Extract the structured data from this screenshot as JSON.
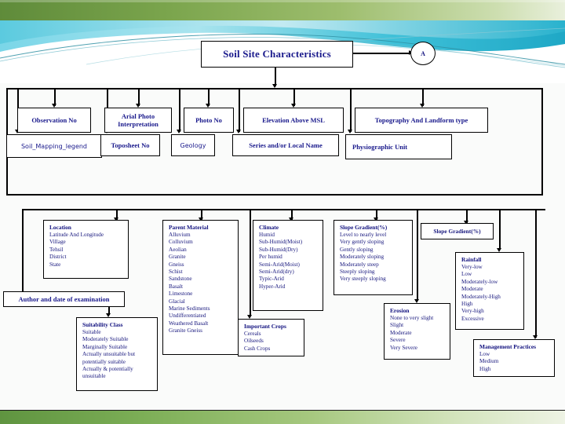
{
  "diagram": {
    "title": "Soil Site Characteristics",
    "connector_label": "A",
    "row1": [
      {
        "label": "Observation No"
      },
      {
        "label": "Arial Photo\nInterpretation"
      },
      {
        "label": "Photo  No"
      },
      {
        "label": "Elevation Above MSL"
      },
      {
        "label": "Topography And Landform type"
      }
    ],
    "row2": [
      {
        "label": "Soil_Mapping_legend"
      },
      {
        "label": "Toposheet No"
      },
      {
        "label": "Geology"
      },
      {
        "label": "Series and/or Local Name"
      },
      {
        "label": "Physiographic Unit"
      }
    ],
    "author_box": "Author and date of examination",
    "lists": [
      {
        "title": "Location",
        "items": [
          "Latitude  And Longitude",
          "Village",
          "Tehsil",
          "District",
          "State"
        ]
      },
      {
        "title": "Parent Material",
        "items": [
          "Alluvium",
          "Colluvium",
          "Aeolian",
          "Granite",
          "Gneiss",
          "Schist",
          "Sandstone",
          "Basalt",
          "Limestone",
          "Glacial",
          "Marine Sediments",
          "Undifferentiated",
          "Weathered Basalt",
          "Granite Gneiss"
        ]
      },
      {
        "title": "Climate",
        "items": [
          "Humid",
          "Sub-Humid(Moist)",
          "Sub-Humid(Dry)",
          "Per humid",
          "Semi-Arid(Moist)",
          "Semi-Arid(dry)",
          "Typic-Arid",
          "Hyper-Arid"
        ]
      },
      {
        "title": "Slope Gradient(%)",
        "items": [
          "Level to nearly level",
          "Very gently sloping",
          "Gently sloping",
          "Moderately sloping",
          "Moderately steep",
          "Steeply sloping",
          "Very steeply sloping"
        ]
      },
      {
        "title": "Slope Gradient(%)",
        "items": []
      },
      {
        "title": "Rainfall",
        "items": [
          "Very-low",
          "Low",
          "Moderately-low",
          "Moderate",
          "Moderately-High",
          "High",
          "Very-high",
          "Excessive"
        ]
      },
      {
        "title": "Erosion",
        "items": [
          "None to very slight",
          "Slight",
          "Moderate",
          "Severe",
          "Very Severe"
        ]
      },
      {
        "title": "Important Crops",
        "items": [
          "Cereals",
          "Oilseeds",
          "Cash Crops"
        ]
      },
      {
        "title": "Management Practices",
        "items": [
          "Low",
          "Medium",
          "High"
        ]
      },
      {
        "title": "Suitability Class",
        "items": [
          "Suitable",
          "Moderately Suitable",
          "Marginally Suitable",
          "Actually unsuitable but",
          "potentially suitable",
          "Actually & potentially",
          "unsuitable"
        ]
      }
    ],
    "colors": {
      "text": "#16167d",
      "border": "#000000",
      "banner_green": "#7ba54d",
      "wave_cyan": "#4fc7de"
    }
  }
}
